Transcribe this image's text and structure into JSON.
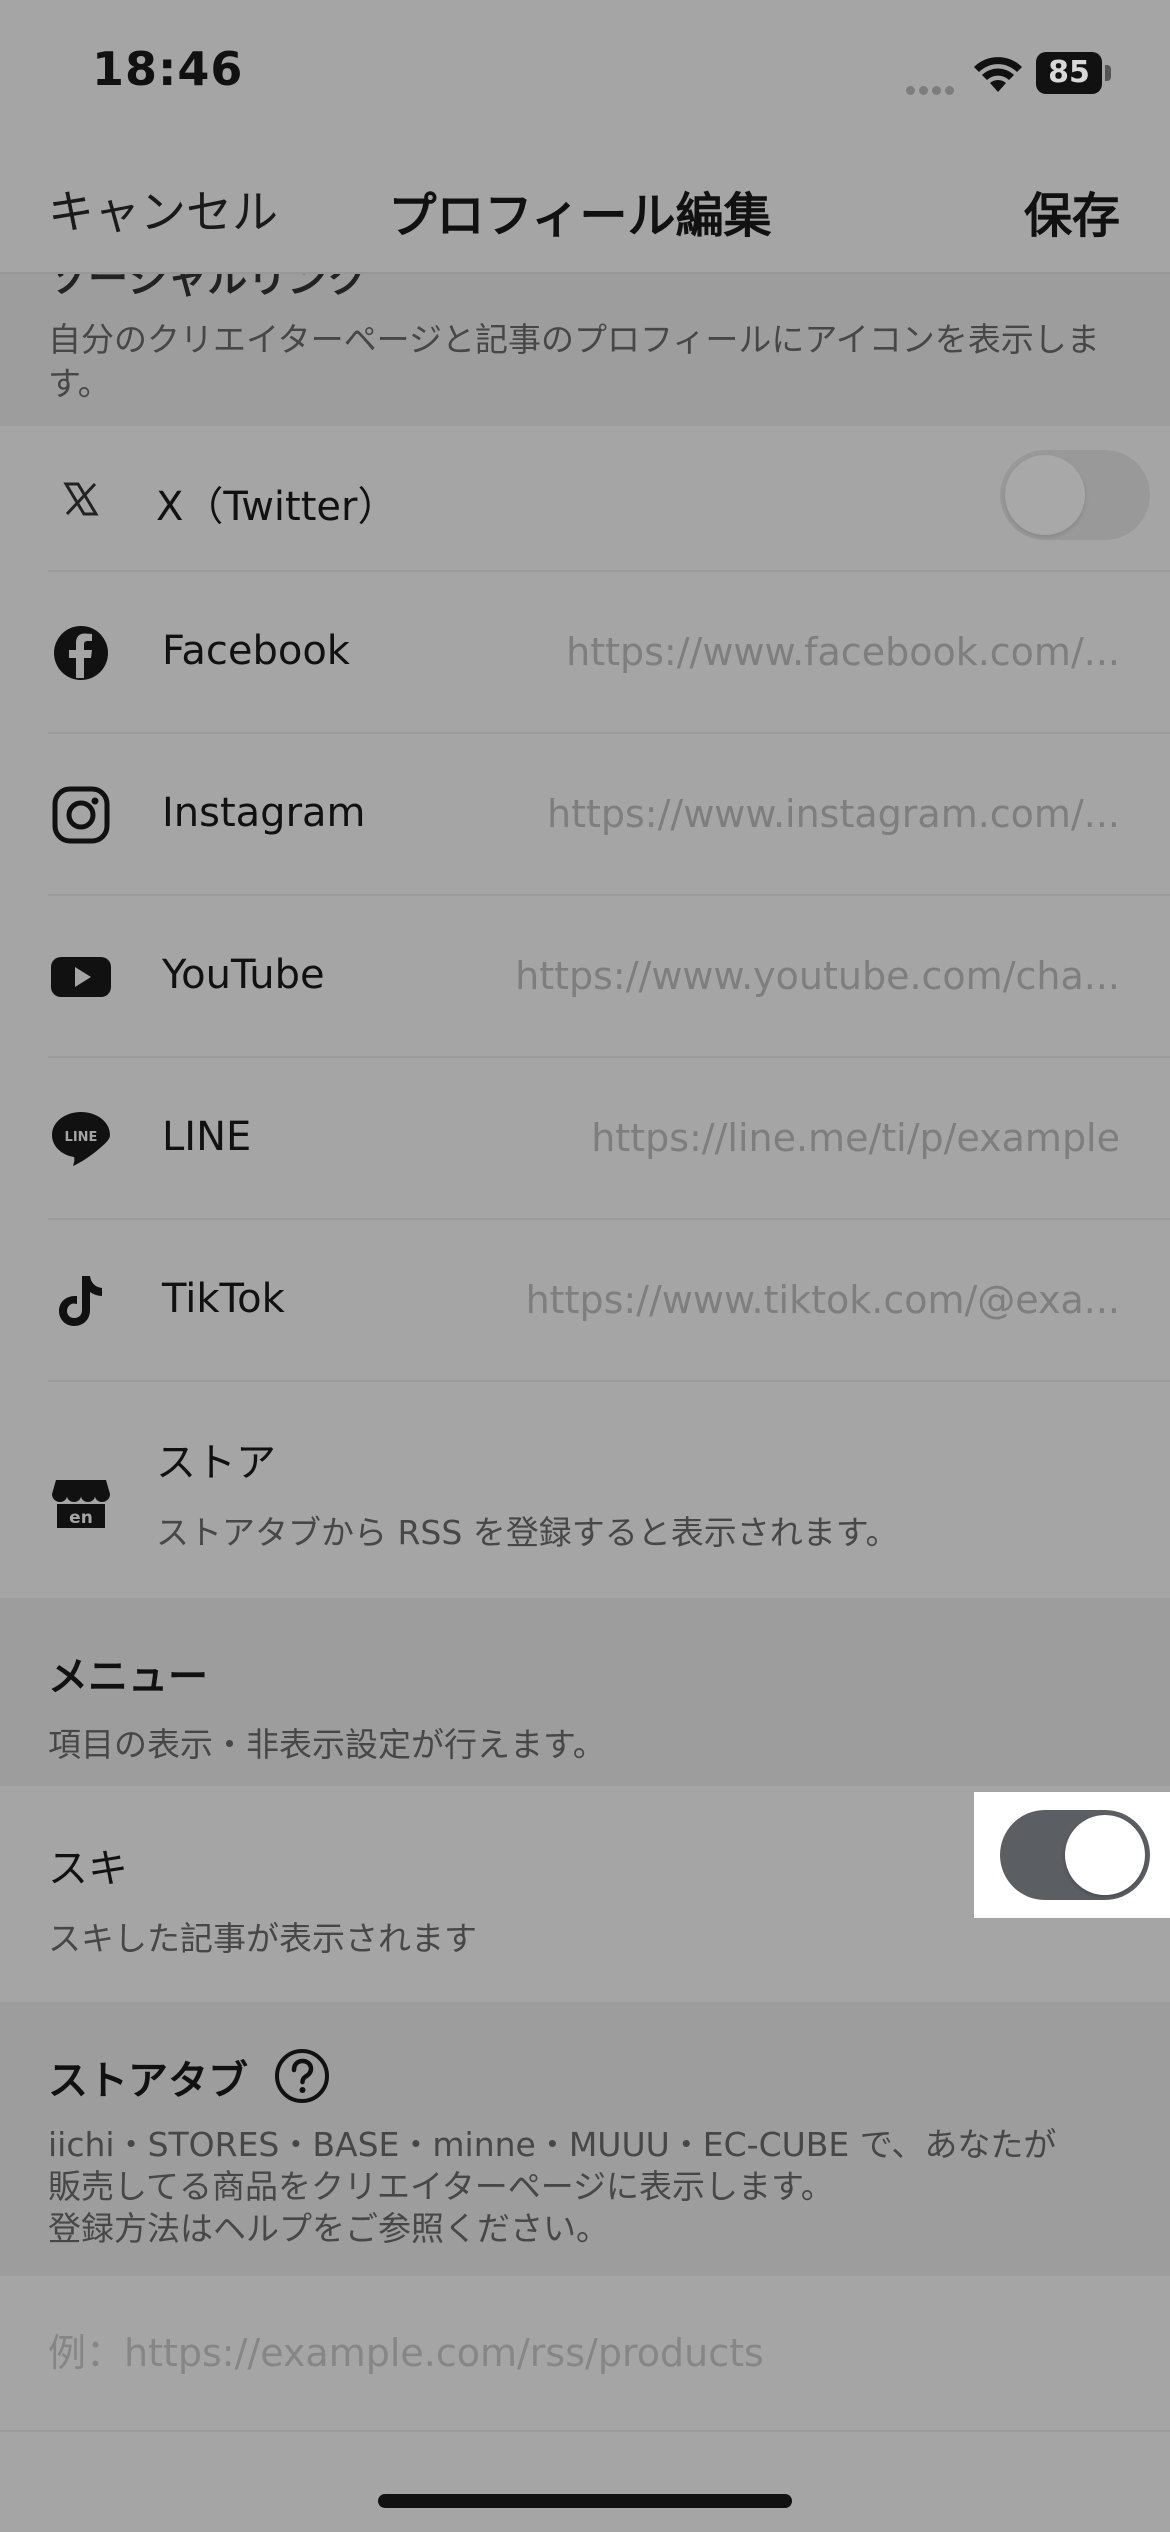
{
  "status_bar": {
    "time": "18:46",
    "battery": "85"
  },
  "nav": {
    "cancel_label": "キャンセル",
    "title": "プロフィール編集",
    "save_label": "保存"
  },
  "sns_section": {
    "title": "ソーシャルリンク",
    "description": "自分のクリエイターページと記事のプロフィールにアイコンを表示します。"
  },
  "sns_rows": {
    "x": {
      "label": "X（Twitter）",
      "icon": "x-logo-icon",
      "enabled": false
    },
    "facebook": {
      "label": "Facebook",
      "placeholder": "https://www.facebook.com/...",
      "icon": "facebook-icon"
    },
    "instagram": {
      "label": "Instagram",
      "placeholder": "https://www.instagram.com/...",
      "icon": "instagram-icon"
    },
    "youtube": {
      "label": "YouTube",
      "placeholder": "https://www.youtube.com/cha...",
      "icon": "youtube-icon"
    },
    "line": {
      "label": "LINE",
      "placeholder": "https://line.me/ti/p/example",
      "icon": "line-icon"
    },
    "tiktok": {
      "label": "TikTok",
      "placeholder": "https://www.tiktok.com/@exa...",
      "icon": "tiktok-icon"
    },
    "store": {
      "label": "ストア",
      "description": "ストアタブから RSS を登録すると表示されます。",
      "icon": "store-icon"
    }
  },
  "menu_section": {
    "title": "メニュー",
    "description": "項目の表示・非表示設定が行えます。",
    "suki": {
      "label": "スキ",
      "description": "スキした記事が表示されます",
      "enabled": true
    }
  },
  "storetab_section": {
    "title": "ストアタブ",
    "help_icon": "question-circle-icon",
    "description_lines": [
      "iichi・STORES・BASE・minne・MUUU・EC-CUBE で、あなたが",
      "販売してる商品をクリエイターページに表示します。",
      "登録方法はヘルプをご参照ください。"
    ],
    "rss_placeholder": "例：https://example.com/rss/products"
  },
  "colors": {
    "toggle_on": "#5b5f64",
    "background_dim": "#a5a5a5"
  }
}
